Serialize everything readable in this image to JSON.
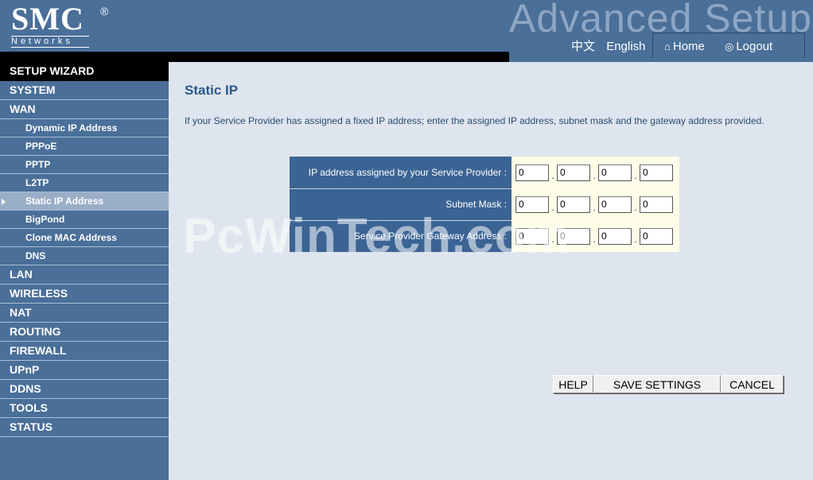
{
  "header": {
    "brand": "SMC",
    "brand_reg": "®",
    "brand_sub": "Networks",
    "advanced_title": "Advanced Setup",
    "lang_chinese": "中文",
    "lang_english": "English",
    "home_label": "Home",
    "logout_label": "Logout"
  },
  "sidebar": {
    "items": [
      {
        "label": "SETUP WIZARD"
      },
      {
        "label": "SYSTEM"
      },
      {
        "label": "WAN"
      },
      {
        "label": "Dynamic IP Address"
      },
      {
        "label": "PPPoE"
      },
      {
        "label": "PPTP"
      },
      {
        "label": "L2TP"
      },
      {
        "label": "Static IP Address"
      },
      {
        "label": "BigPond"
      },
      {
        "label": "Clone MAC Address"
      },
      {
        "label": "DNS"
      },
      {
        "label": "LAN"
      },
      {
        "label": "WIRELESS"
      },
      {
        "label": "NAT"
      },
      {
        "label": "ROUTING"
      },
      {
        "label": "FIREWALL"
      },
      {
        "label": "UPnP"
      },
      {
        "label": "DDNS"
      },
      {
        "label": "TOOLS"
      },
      {
        "label": "STATUS"
      }
    ],
    "active": "Static IP Address"
  },
  "main": {
    "title": "Static IP",
    "description": "If your Service Provider has assigned a fixed IP address; enter the assigned IP address, subnet mask and the gateway address provided.",
    "rows": [
      {
        "label": "IP address assigned by your Service Provider :",
        "octets": [
          "0",
          "0",
          "0",
          "0"
        ]
      },
      {
        "label": "Subnet Mask :",
        "octets": [
          "0",
          "0",
          "0",
          "0"
        ]
      },
      {
        "label": "Service Provider Gateway Address :",
        "octets": [
          "0",
          "0",
          "0",
          "0"
        ]
      }
    ],
    "watermark": "PcWinTech.com"
  },
  "buttons": {
    "help": "HELP",
    "save": "SAVE SETTINGS",
    "cancel": "CANCEL"
  },
  "colors": {
    "header_bg": "#4a6f99",
    "label_cell_bg": "#3b6494",
    "value_cell_bg": "#fdfde8",
    "page_bg": "#dfe5ee",
    "title_color": "#2c5a8c"
  }
}
